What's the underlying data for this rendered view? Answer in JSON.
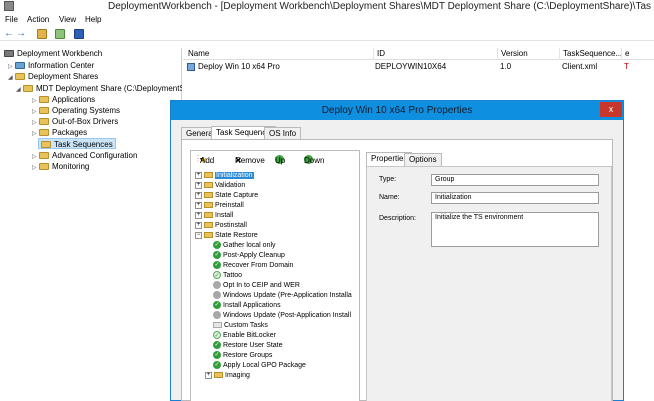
{
  "window": {
    "title": "DeploymentWorkbench - [Deployment Workbench\\Deployment Shares\\MDT Deployment Share (C:\\DeploymentShare)\\Tas"
  },
  "menu": [
    "File",
    "Action",
    "View",
    "Help"
  ],
  "tree": {
    "root": "Deployment Workbench",
    "info_center": "Information Center",
    "deployment_shares": "Deployment Shares",
    "share": "MDT Deployment Share (C:\\DeploymentS",
    "children": [
      "Applications",
      "Operating Systems",
      "Out-of-Box Drivers",
      "Packages",
      "Task Sequences",
      "Advanced Configuration",
      "Monitoring"
    ]
  },
  "list": {
    "columns": [
      "Name",
      "ID",
      "Version",
      "TaskSequence...",
      "e"
    ],
    "row": {
      "name": "Deploy Win 10 x64 Pro",
      "id": "DEPLOYWIN10X64",
      "version": "1.0",
      "template": "Client.xml",
      "extra": "T"
    }
  },
  "dialog": {
    "title": "Deploy Win 10 x64 Pro Properties",
    "close": "x",
    "tabs": [
      "General",
      "Task Sequence",
      "OS Info"
    ],
    "ts_toolbar": {
      "add": "Add",
      "remove": "Remove",
      "up": "Up",
      "down": "Down"
    },
    "steps": [
      {
        "label": "Initialization",
        "kind": "group",
        "level": 0
      },
      {
        "label": "Validation",
        "kind": "group",
        "level": 0
      },
      {
        "label": "State Capture",
        "kind": "group",
        "level": 0
      },
      {
        "label": "Preinstall",
        "kind": "group",
        "level": 0
      },
      {
        "label": "Install",
        "kind": "group",
        "level": 0
      },
      {
        "label": "Postinstall",
        "kind": "group",
        "level": 0
      },
      {
        "label": "State Restore",
        "kind": "group-open",
        "level": 0
      },
      {
        "label": "Gather local only",
        "kind": "check",
        "level": 1
      },
      {
        "label": "Post-Apply Cleanup",
        "kind": "check",
        "level": 1
      },
      {
        "label": "Recover From Domain",
        "kind": "check",
        "level": 1
      },
      {
        "label": "Tattoo",
        "kind": "check-light",
        "level": 1
      },
      {
        "label": "Opt In to CEIP and WER",
        "kind": "grey",
        "level": 1
      },
      {
        "label": "Windows Update (Pre-Application Installa",
        "kind": "grey",
        "level": 1
      },
      {
        "label": "Install Applications",
        "kind": "check",
        "level": 1
      },
      {
        "label": "Windows Update (Post-Application Install",
        "kind": "grey",
        "level": 1
      },
      {
        "label": "Custom Tasks",
        "kind": "folder",
        "level": 1
      },
      {
        "label": "Enable BitLocker",
        "kind": "check-light",
        "level": 1
      },
      {
        "label": "Restore User State",
        "kind": "check",
        "level": 1
      },
      {
        "label": "Restore Groups",
        "kind": "check",
        "level": 1
      },
      {
        "label": "Apply Local GPO Package",
        "kind": "check",
        "level": 1
      },
      {
        "label": "Imaging",
        "kind": "group",
        "level": 1
      }
    ],
    "props_tabs": [
      "Properties",
      "Options"
    ],
    "props": {
      "type_label": "Type:",
      "type_value": "Group",
      "name_label": "Name:",
      "name_value": "Initialization",
      "desc_label": "Description:",
      "desc_value": "Initialize the TS environment"
    }
  }
}
